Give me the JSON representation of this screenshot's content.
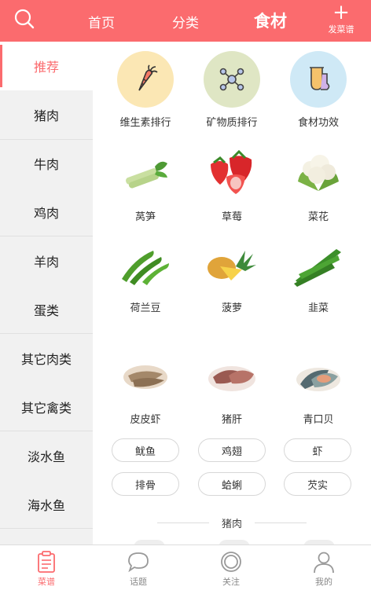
{
  "header": {
    "tabs": [
      {
        "label": "首页"
      },
      {
        "label": "分类"
      },
      {
        "label": "食材",
        "active": true
      }
    ],
    "publish_label": "发菜谱",
    "accent": "#fb6b6e"
  },
  "sidebar": {
    "items": [
      {
        "label": "推荐",
        "active": true
      },
      {
        "label": "猪肉"
      },
      {
        "label": "牛肉"
      },
      {
        "label": "鸡肉"
      },
      {
        "label": "羊肉"
      },
      {
        "label": "蛋类"
      },
      {
        "label": "其它肉类"
      },
      {
        "label": "其它禽类"
      },
      {
        "label": "淡水鱼"
      },
      {
        "label": "海水鱼"
      }
    ]
  },
  "main": {
    "features": [
      {
        "label": "维生素排行",
        "icon": "carrot-icon"
      },
      {
        "label": "矿物质排行",
        "icon": "molecule-icon"
      },
      {
        "label": "食材功效",
        "icon": "flask-icon"
      }
    ],
    "foods": [
      {
        "label": "莴笋",
        "icon": "lettuce-stem-icon"
      },
      {
        "label": "草莓",
        "icon": "strawberry-icon"
      },
      {
        "label": "菜花",
        "icon": "cauliflower-icon"
      },
      {
        "label": "荷兰豆",
        "icon": "snow-pea-icon"
      },
      {
        "label": "菠萝",
        "icon": "pineapple-icon"
      },
      {
        "label": "韭菜",
        "icon": "chive-icon"
      },
      {
        "label": "皮皮虾",
        "icon": "mantis-shrimp-icon"
      },
      {
        "label": "猪肝",
        "icon": "pork-liver-icon"
      },
      {
        "label": "青口贝",
        "icon": "mussel-icon"
      }
    ],
    "tags": [
      {
        "label": "鱿鱼"
      },
      {
        "label": "鸡翅"
      },
      {
        "label": "虾"
      },
      {
        "label": "排骨"
      },
      {
        "label": "蛤蜊"
      },
      {
        "label": "芡实"
      }
    ],
    "section_title": "猪肉"
  },
  "bottom_nav": [
    {
      "label": "菜谱",
      "icon": "clipboard-icon",
      "active": true
    },
    {
      "label": "话题",
      "icon": "chat-bubble-icon"
    },
    {
      "label": "关注",
      "icon": "circle-icon"
    },
    {
      "label": "我的",
      "icon": "person-icon"
    }
  ]
}
